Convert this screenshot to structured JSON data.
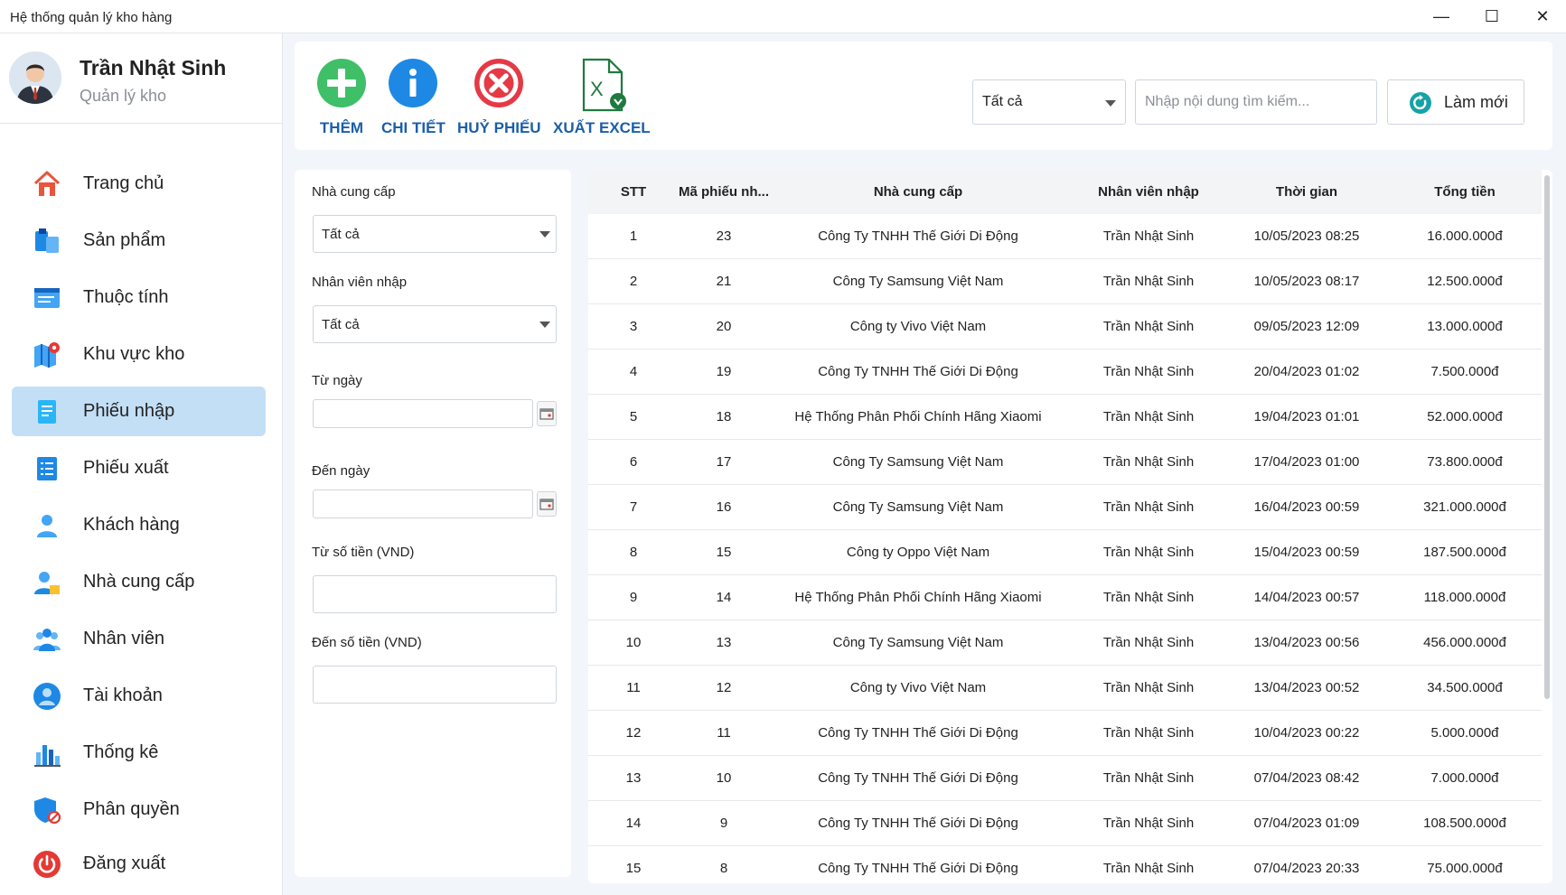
{
  "window": {
    "title": "Hệ thống quản lý kho hàng",
    "minimize_glyph": "—",
    "maximize_glyph": "☐",
    "close_glyph": "✕"
  },
  "user": {
    "name": "Trần Nhật Sinh",
    "role": "Quản lý kho"
  },
  "sidebar": {
    "items": [
      {
        "label": "Trang chủ",
        "icon": "home-icon"
      },
      {
        "label": "Sản phẩm",
        "icon": "product-icon"
      },
      {
        "label": "Thuộc tính",
        "icon": "attribute-icon"
      },
      {
        "label": "Khu vực kho",
        "icon": "map-pin-icon"
      },
      {
        "label": "Phiếu nhập",
        "icon": "receipt-icon",
        "active": true
      },
      {
        "label": "Phiếu xuất",
        "icon": "list-icon"
      },
      {
        "label": "Khách hàng",
        "icon": "user-icon"
      },
      {
        "label": "Nhà cung cấp",
        "icon": "supplier-icon"
      },
      {
        "label": "Nhân viên",
        "icon": "group-icon"
      },
      {
        "label": "Tài khoản",
        "icon": "account-icon"
      },
      {
        "label": "Thống kê",
        "icon": "chart-icon"
      },
      {
        "label": "Phân quyền",
        "icon": "shield-icon"
      }
    ],
    "logout_label": "Đăng xuất",
    "active_color": "#c3dff6"
  },
  "toolbar": {
    "add_label": "THÊM",
    "detail_label": "CHI TIẾT",
    "cancel_label": "HUỶ PHIẾU",
    "export_label": "XUẤT EXCEL",
    "filter_value": "Tất cả",
    "search_placeholder": "Nhập nội dung tìm kiếm...",
    "refresh_label": "Làm mới",
    "label_color": "#1b5fa8"
  },
  "filters": {
    "supplier_label": "Nhà cung cấp",
    "supplier_value": "Tất cả",
    "employee_label": "Nhân viên nhập",
    "employee_value": "Tất cả",
    "from_date_label": "Từ ngày",
    "to_date_label": "Đến ngày",
    "from_amount_label": "Từ số tiền (VND)",
    "to_amount_label": "Đến số tiền (VND)"
  },
  "table": {
    "columns": [
      "STT",
      "Mã phiếu nh...",
      "Nhà cung cấp",
      "Nhân viên nhập",
      "Thời gian",
      "Tổng tiền"
    ],
    "rows": [
      [
        "1",
        "23",
        "Công Ty TNHH Thế Giới Di Động",
        "Trần Nhật Sinh",
        "10/05/2023 08:25",
        "16.000.000đ"
      ],
      [
        "2",
        "21",
        "Công Ty Samsung Việt Nam",
        "Trần Nhật Sinh",
        "10/05/2023 08:17",
        "12.500.000đ"
      ],
      [
        "3",
        "20",
        "Công ty Vivo Việt Nam",
        "Trần Nhật Sinh",
        "09/05/2023 12:09",
        "13.000.000đ"
      ],
      [
        "4",
        "19",
        "Công Ty TNHH Thế Giới Di Động",
        "Trần Nhật Sinh",
        "20/04/2023 01:02",
        "7.500.000đ"
      ],
      [
        "5",
        "18",
        "Hệ Thống Phân Phối Chính Hãng Xiaomi",
        "Trần Nhật Sinh",
        "19/04/2023 01:01",
        "52.000.000đ"
      ],
      [
        "6",
        "17",
        "Công Ty Samsung Việt Nam",
        "Trần Nhật Sinh",
        "17/04/2023 01:00",
        "73.800.000đ"
      ],
      [
        "7",
        "16",
        "Công Ty Samsung Việt Nam",
        "Trần Nhật Sinh",
        "16/04/2023 00:59",
        "321.000.000đ"
      ],
      [
        "8",
        "15",
        "Công ty Oppo Việt Nam",
        "Trần Nhật Sinh",
        "15/04/2023 00:59",
        "187.500.000đ"
      ],
      [
        "9",
        "14",
        "Hệ Thống Phân Phối Chính Hãng Xiaomi",
        "Trần Nhật Sinh",
        "14/04/2023 00:57",
        "118.000.000đ"
      ],
      [
        "10",
        "13",
        "Công Ty Samsung Việt Nam",
        "Trần Nhật Sinh",
        "13/04/2023 00:56",
        "456.000.000đ"
      ],
      [
        "11",
        "12",
        "Công ty Vivo Việt Nam",
        "Trần Nhật Sinh",
        "13/04/2023 00:52",
        "34.500.000đ"
      ],
      [
        "12",
        "11",
        "Công Ty TNHH Thế Giới Di Động",
        "Trần Nhật Sinh",
        "10/04/2023 00:22",
        "5.000.000đ"
      ],
      [
        "13",
        "10",
        "Công Ty TNHH Thế Giới Di Động",
        "Trần Nhật Sinh",
        "07/04/2023 08:42",
        "7.000.000đ"
      ],
      [
        "14",
        "9",
        "Công Ty TNHH Thế Giới Di Động",
        "Trần Nhật Sinh",
        "07/04/2023 01:09",
        "108.500.000đ"
      ],
      [
        "15",
        "8",
        "Công Ty TNHH Thế Giới Di Động",
        "Trần Nhật Sinh",
        "07/04/2023 20:33",
        "75.000.000đ"
      ]
    ]
  }
}
